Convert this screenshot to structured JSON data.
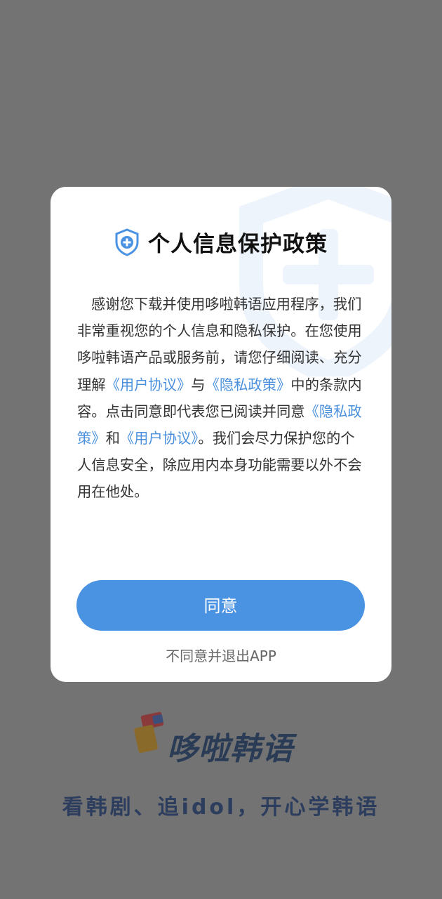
{
  "dialog": {
    "title": "个人信息保护政策",
    "body": {
      "p1": "感谢您下载并使用哆啦韩语应用程序，我们非常重视您的个人信息和隐私保护。在您使用哆啦韩语产品或服务前，请您仔细阅读、充分理解",
      "link_user_agreement_1": "《用户协议》",
      "t2": "与",
      "link_privacy_policy_1": "《隐私政策》",
      "t3": "中的条款内容。点击同意即代表您已阅读并同意",
      "link_privacy_policy_2": "《隐私政策》",
      "t4": "和",
      "link_user_agreement_2": "《用户协议》",
      "t5": "。我们会尽力保护您的个人信息安全，除应用内本身功能需要以外不会用在他处。"
    },
    "agree_label": "同意",
    "disagree_label": "不同意并退出APP"
  },
  "splash": {
    "logo_text": "哆啦韩语",
    "slogan": "看韩剧、追idol，开心学韩语"
  },
  "colors": {
    "overlay": "#737373",
    "accent": "#4a92e2",
    "link": "#4a90dd",
    "brand_dark": "#2a3b55"
  },
  "icons": {
    "title_icon": "shield-plus-icon",
    "watermark": "shield-watermark-icon",
    "logo": "app-logo-icon"
  }
}
